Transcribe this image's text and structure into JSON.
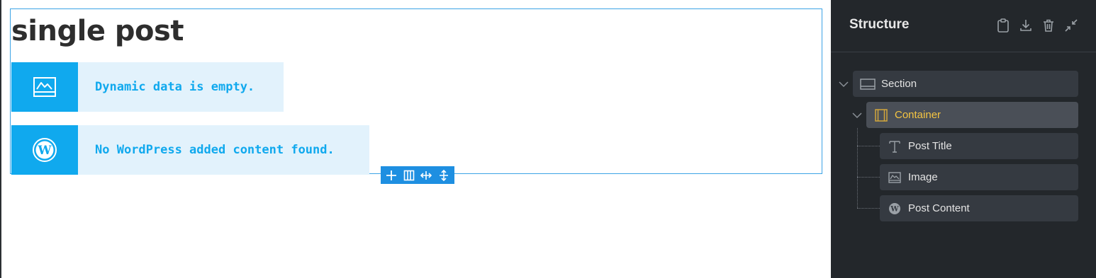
{
  "canvas": {
    "post_title": "single post",
    "notices": [
      {
        "icon": "image-icon",
        "text": "Dynamic data is empty."
      },
      {
        "icon": "wordpress-icon",
        "text": "No WordPress added content found."
      }
    ],
    "toolbar": [
      "add-icon",
      "columns-icon",
      "horizontal-resize-icon",
      "vertical-resize-icon"
    ]
  },
  "structure_panel": {
    "title": "Structure",
    "actions": [
      "clipboard-icon",
      "download-icon",
      "trash-icon",
      "collapse-icon"
    ],
    "tree": [
      {
        "label": "Section",
        "icon": "section-icon",
        "level": 0,
        "expanded": true
      },
      {
        "label": "Container",
        "icon": "container-icon",
        "level": 1,
        "expanded": true,
        "active": true
      },
      {
        "label": "Post Title",
        "icon": "text-icon",
        "level": 2
      },
      {
        "label": "Image",
        "icon": "image-icon",
        "level": 2
      },
      {
        "label": "Post Content",
        "icon": "wordpress-icon",
        "level": 2
      }
    ]
  },
  "colors": {
    "accent_blue": "#10a9ee",
    "notice_bg": "#e2f2fc",
    "panel_bg": "#23272b",
    "active_label": "#f5c542"
  }
}
